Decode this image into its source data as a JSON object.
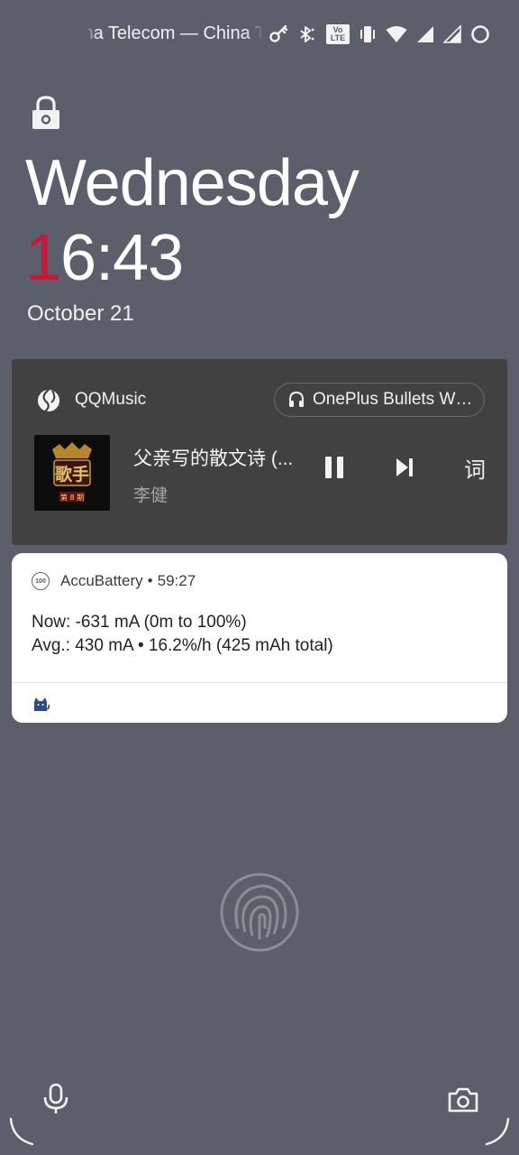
{
  "status_bar": {
    "carrier": "ina Telecom — China T",
    "lte_badge": "Vo LTE",
    "icons": [
      "key-icon",
      "bluetooth-icon",
      "volte-icon",
      "vibrate-icon",
      "wifi-icon",
      "signal-icon",
      "signal-icon",
      "battery-ring-icon"
    ]
  },
  "lockscreen": {
    "day": "Wednesday",
    "time_first": "1",
    "time_rest": "6:43",
    "date": "October 21",
    "accent_color": "#c8173a"
  },
  "media": {
    "app_name": "QQMusic",
    "output_device": "OnePlus Bullets Wi...",
    "song_title": "父亲写的散文诗 (...",
    "artist": "李健",
    "lyrics_label": "词",
    "album_art_text": "歌手",
    "album_art_sub": "第 8 期"
  },
  "battery_notification": {
    "app_name": "AccuBattery",
    "separator": "•",
    "elapsed": "59:27",
    "icon_text": "100",
    "line1": "Now: -631 mA (0m to 100%)",
    "line2": "Avg.: 430 mA • 16.2%/h (425 mAh total)"
  },
  "shortcuts": {
    "left": "microphone-icon",
    "right": "camera-icon"
  }
}
